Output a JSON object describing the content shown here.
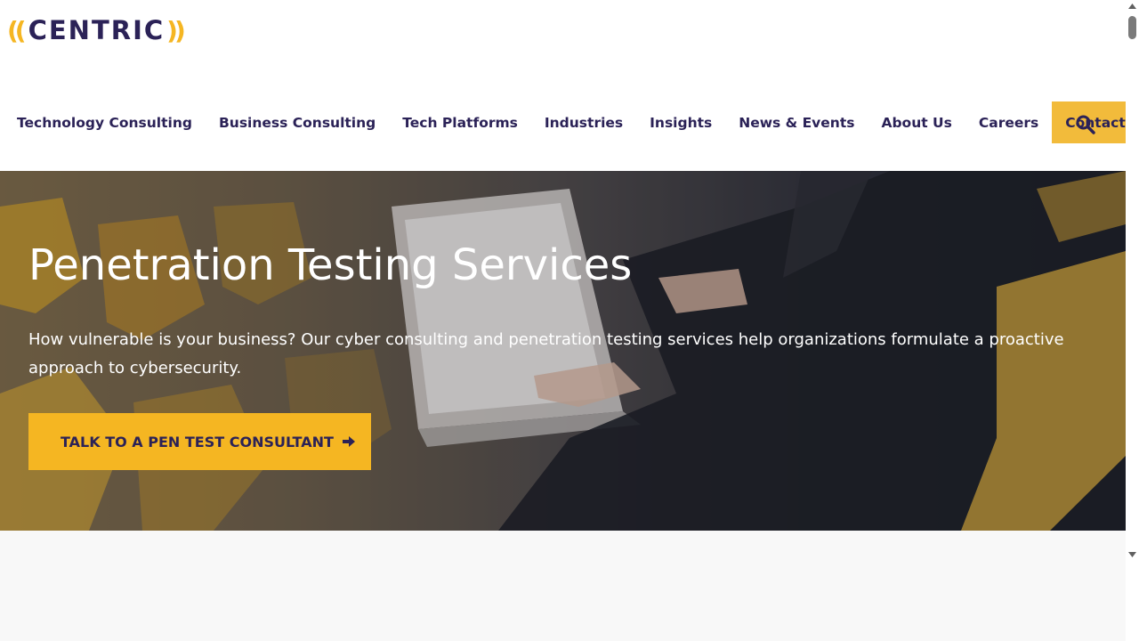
{
  "brand": {
    "logo_paren_left": "((",
    "logo_word": "CENTRIC",
    "logo_paren_right": "))",
    "colors": {
      "navy": "#2b2257",
      "gold": "#f5b622"
    }
  },
  "nav": {
    "items": [
      "Technology Consulting",
      "Business Consulting",
      "Tech Platforms",
      "Industries",
      "Insights",
      "News & Events",
      "About Us",
      "Careers"
    ],
    "contact_label": "Contact Us",
    "search_icon": "search-icon"
  },
  "hero": {
    "title": "Penetration Testing Services",
    "description": "How vulnerable is your business? Our cyber consulting and penetration testing services help organizations formulate a proactive approach to cybersecurity.",
    "cta_label": "TALK TO A PEN TEST CONSULTANT",
    "cta_icon": "arrow-right-icon"
  }
}
